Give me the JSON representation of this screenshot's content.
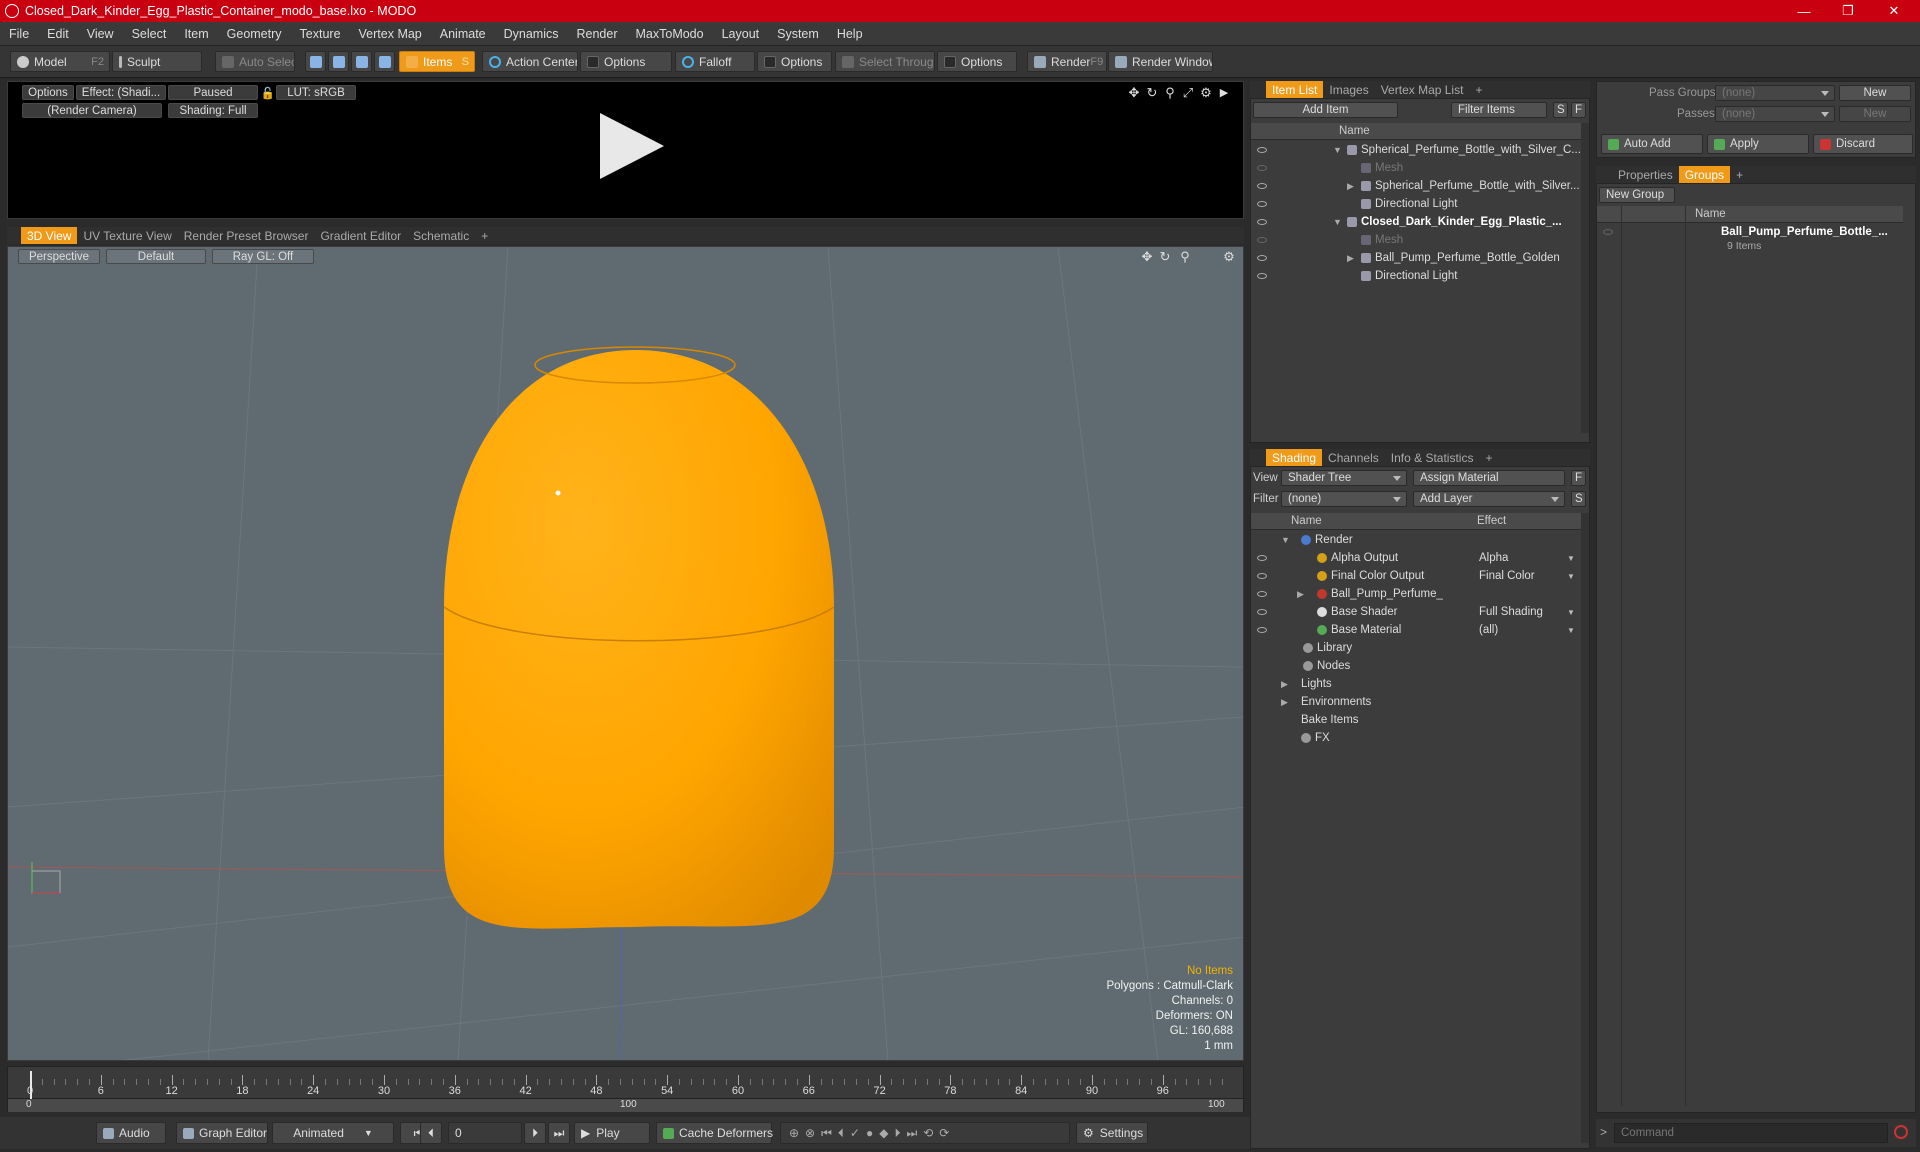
{
  "window": {
    "title": "Closed_Dark_Kinder_Egg_Plastic_Container_modo_base.lxo - MODO",
    "min": "—",
    "max": "❐",
    "close": "✕"
  },
  "menu": [
    "File",
    "Edit",
    "View",
    "Select",
    "Item",
    "Geometry",
    "Texture",
    "Vertex Map",
    "Animate",
    "Dynamics",
    "Render",
    "MaxToModo",
    "Layout",
    "System",
    "Help"
  ],
  "toolbar": {
    "model": "Model",
    "model_key": "F2",
    "sculpt": "Sculpt",
    "auto_select": "Auto Select",
    "items": "Items",
    "items_key": "S",
    "action_center": "Action Center",
    "options1": "Options",
    "falloff": "Falloff",
    "options2": "Options",
    "select_through": "Select Through",
    "options3": "Options",
    "render": "Render",
    "render_key": "F9",
    "render_window": "Render Window"
  },
  "preview": {
    "options": "Options",
    "effect": "Effect: (Shadi...",
    "paused": "Paused",
    "lut": "LUT: sRGB",
    "camera": "(Render Camera)",
    "shading": "Shading: Full"
  },
  "viewport_tabs": [
    "3D View",
    "UV Texture View",
    "Render Preset Browser",
    "Gradient Editor",
    "Schematic",
    "+"
  ],
  "viewport": {
    "perspective": "Perspective",
    "default": "Default",
    "raygl": "Ray GL: Off",
    "stats": {
      "no_items": "No Items",
      "polygons": "Polygons : Catmull-Clark",
      "channels": "Channels: 0",
      "deformers": "Deformers: ON",
      "gl": "GL: 160,688",
      "unit": "1 mm"
    },
    "object_color": "#ffa500"
  },
  "timeline": {
    "ticks": [
      "0",
      "6",
      "12",
      "18",
      "24",
      "30",
      "36",
      "42",
      "48",
      "54",
      "60",
      "66",
      "72",
      "78",
      "84",
      "90",
      "96"
    ],
    "sub": [
      "0",
      "100",
      "100"
    ]
  },
  "bottom": {
    "audio": "Audio",
    "graph_editor": "Graph Editor",
    "animated": "Animated",
    "frame": "0",
    "play": "Play",
    "cache": "Cache Deformers",
    "settings": "Settings"
  },
  "item_list": {
    "tabs": [
      "Item List",
      "Images",
      "Vertex Map List",
      "+"
    ],
    "add_item": "Add Item",
    "filter": "Filter Items",
    "s": "S",
    "f": "F",
    "name_col": "Name",
    "rows": [
      {
        "label": "Spherical_Perfume_Bottle_with_Silver_C...",
        "bold": false,
        "dim": false
      },
      {
        "label": "Mesh",
        "bold": false,
        "dim": true
      },
      {
        "label": "Spherical_Perfume_Bottle_with_Silver...",
        "bold": false,
        "dim": false
      },
      {
        "label": "Directional Light",
        "bold": false,
        "dim": false
      },
      {
        "label": "Closed_Dark_Kinder_Egg_Plastic_...",
        "bold": true,
        "dim": false
      },
      {
        "label": "Mesh",
        "bold": false,
        "dim": true
      },
      {
        "label": "Ball_Pump_Perfume_Bottle_Golden",
        "bold": false,
        "dim": false
      },
      {
        "label": "Directional Light",
        "bold": false,
        "dim": false
      }
    ]
  },
  "shading": {
    "tabs": [
      "Shading",
      "Channels",
      "Info & Statistics",
      "+"
    ],
    "view_label": "View",
    "view_value": "Shader Tree",
    "assign": "Assign Material",
    "f": "F",
    "filter_label": "Filter",
    "filter_value": "(none)",
    "add_layer": "Add Layer",
    "s": "S",
    "name_col": "Name",
    "effect_col": "Effect",
    "rows": [
      {
        "label": "Render",
        "effect": ""
      },
      {
        "label": "Alpha Output",
        "effect": "Alpha"
      },
      {
        "label": "Final Color Output",
        "effect": "Final Color"
      },
      {
        "label": "Ball_Pump_Perfume_Bottle...",
        "effect": ""
      },
      {
        "label": "Base Shader",
        "effect": "Full Shading"
      },
      {
        "label": "Base Material",
        "effect": "(all)"
      },
      {
        "label": "Library",
        "effect": ""
      },
      {
        "label": "Nodes",
        "effect": ""
      },
      {
        "label": "Lights",
        "effect": ""
      },
      {
        "label": "Environments",
        "effect": ""
      },
      {
        "label": "Bake Items",
        "effect": ""
      },
      {
        "label": "FX",
        "effect": ""
      }
    ]
  },
  "groups_panel": {
    "pass_groups": "Pass Groups",
    "pass_value": "(none)",
    "new": "New",
    "passes": "Passes",
    "passes_value": "(none)",
    "new2": "New",
    "auto_add": "Auto Add",
    "apply": "Apply",
    "discard": "Discard",
    "tabs": [
      "Properties",
      "Groups",
      "+"
    ],
    "new_group": "New Group",
    "name_col": "Name",
    "group_name": "Ball_Pump_Perfume_Bottle_...",
    "group_count": "9 Items"
  },
  "command": {
    "placeholder": "Command"
  }
}
